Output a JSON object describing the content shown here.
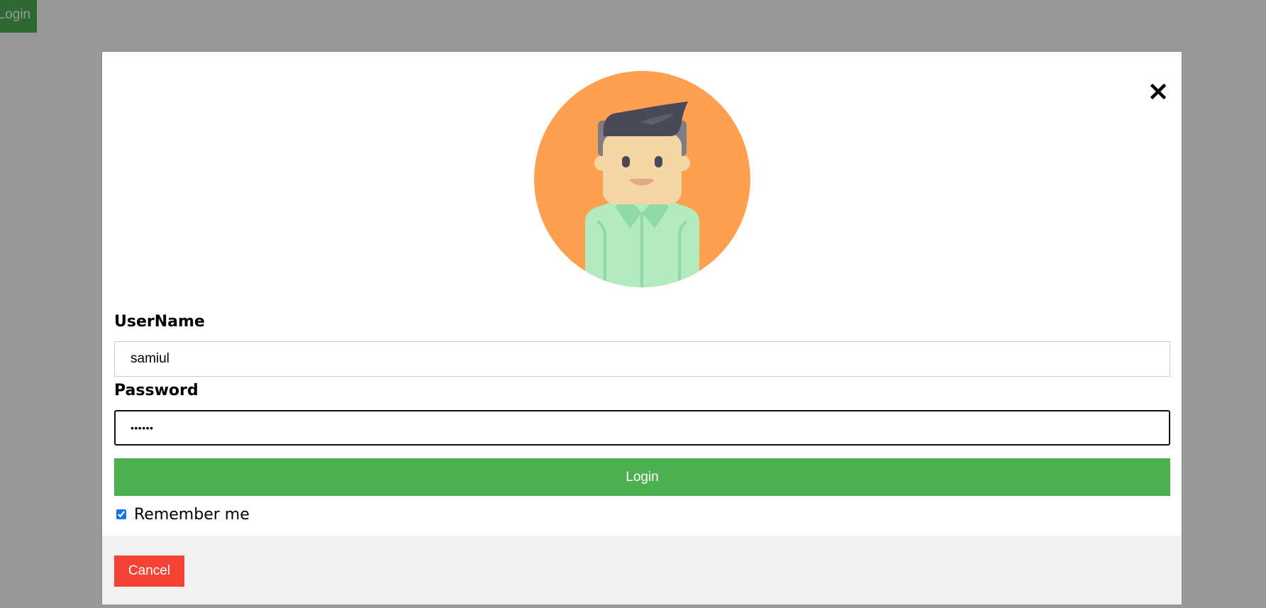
{
  "page": {
    "login_button_label": "Login"
  },
  "modal": {
    "close_glyph": "×",
    "avatar_icon": "user-avatar-icon",
    "username_label": "UserName",
    "username_value": "samiul",
    "password_label": "Password",
    "password_value": "samiul",
    "login_label": "Login",
    "remember_label": "Remember me",
    "remember_checked": true,
    "cancel_label": "Cancel"
  },
  "colors": {
    "green": "#4CAF50",
    "red": "#f44336",
    "avatar_bg": "#FF9F50",
    "overlay": "rgba(0,0,0,0.4)",
    "footer_bg": "#f1f1f1"
  }
}
